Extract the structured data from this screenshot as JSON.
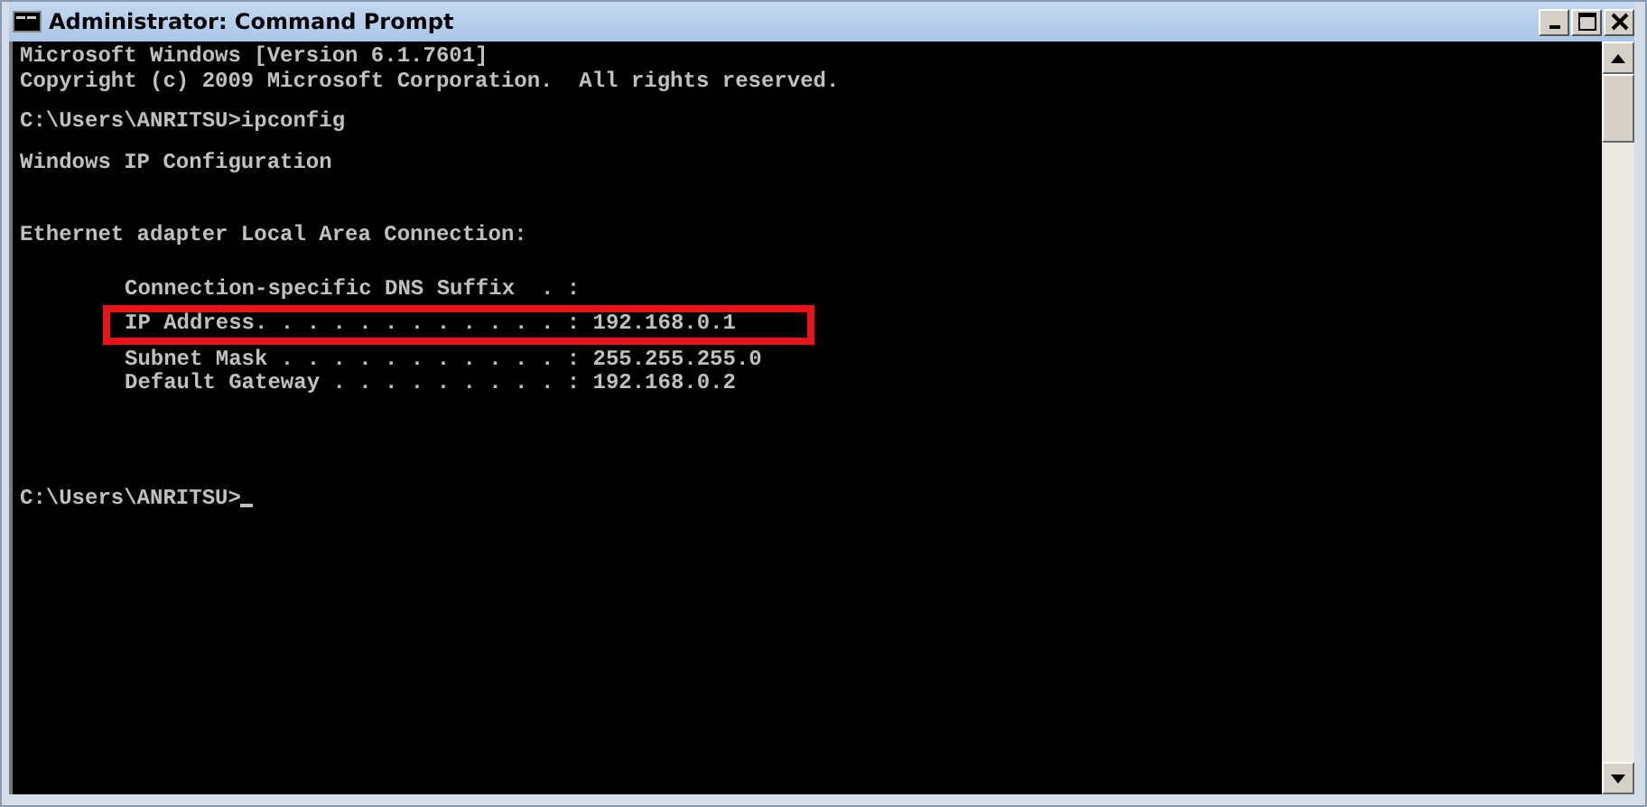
{
  "window": {
    "title": "Administrator: Command Prompt"
  },
  "console": {
    "blocks": [
      {
        "lines": [
          {
            "text": "Microsoft Windows [Version 6.1.7601]",
            "highlighted": false
          },
          {
            "text": "Copyright (c) 2009 Microsoft Corporation.  All rights reserved.",
            "highlighted": false
          }
        ]
      },
      {
        "lines": [
          {
            "text": "C:\\Users\\ANRITSU>ipconfig",
            "highlighted": false
          }
        ]
      },
      {
        "lines": [
          {
            "text": "Windows IP Configuration",
            "highlighted": false
          }
        ]
      },
      {
        "lines": [
          {
            "text": "Ethernet adapter Local Area Connection:",
            "highlighted": false
          }
        ]
      },
      {
        "kind": "indented",
        "lines": [
          {
            "text": "Connection-specific DNS Suffix  . :",
            "highlighted": false
          },
          {
            "text": "IP Address. . . . . . . . . . . . : 192.168.0.1",
            "highlighted": true
          },
          {
            "text": "Subnet Mask . . . . . . . . . . . : 255.255.255.0",
            "highlighted": false
          },
          {
            "text": "Default Gateway . . . . . . . . . : 192.168.0.2",
            "highlighted": false
          }
        ]
      },
      {
        "lines": [
          {
            "text": "C:\\Users\\ANRITSU>",
            "highlighted": false,
            "cursor": true
          }
        ]
      }
    ]
  }
}
